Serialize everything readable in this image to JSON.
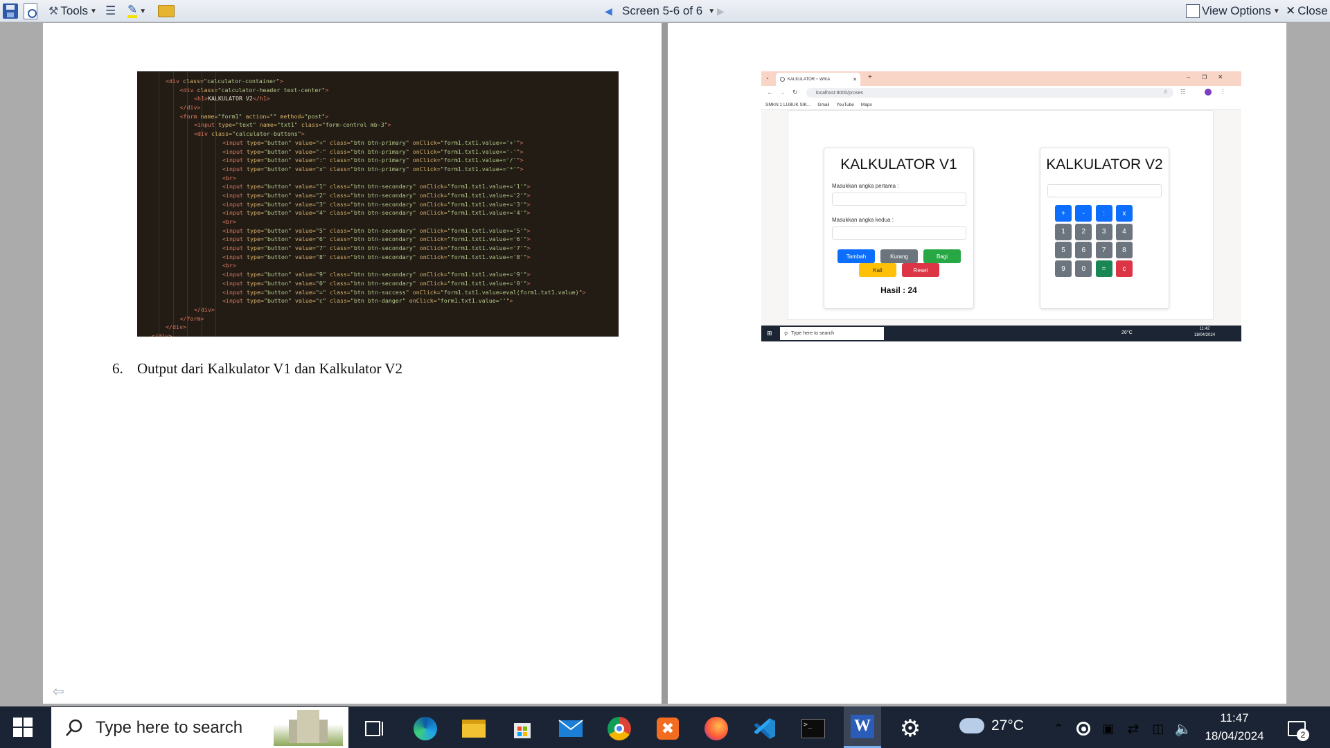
{
  "toolbar": {
    "tools_label": "Tools",
    "screen_label": "Screen 5-6 of 6",
    "view_options_label": "View Options",
    "close_label": "Close"
  },
  "left_page": {
    "code_lines": [
      {
        "indent": 2,
        "parts": [
          [
            "t",
            "<div "
          ],
          [
            "a",
            "class="
          ],
          [
            "s",
            "\"calculator-container\""
          ],
          [
            "t",
            ">"
          ]
        ]
      },
      {
        "indent": 3,
        "parts": [
          [
            "t",
            "<div "
          ],
          [
            "a",
            "class="
          ],
          [
            "s",
            "\"calculator-header text-center\""
          ],
          [
            "t",
            ">"
          ]
        ]
      },
      {
        "indent": 4,
        "parts": [
          [
            "t",
            "<h1>"
          ],
          [
            "p",
            "KALKULATOR V2"
          ],
          [
            "t",
            "</h1>"
          ]
        ]
      },
      {
        "indent": 3,
        "parts": [
          [
            "t",
            "</div>"
          ]
        ]
      },
      {
        "indent": 3,
        "parts": [
          [
            "t",
            "<form "
          ],
          [
            "a",
            "name="
          ],
          [
            "s",
            "\"form1\" "
          ],
          [
            "a",
            "action="
          ],
          [
            "s",
            "\"\" "
          ],
          [
            "a",
            "method="
          ],
          [
            "s",
            "\"post\""
          ],
          [
            "t",
            ">"
          ]
        ]
      },
      {
        "indent": 4,
        "parts": [
          [
            "t",
            "<input "
          ],
          [
            "a",
            "type="
          ],
          [
            "s",
            "\"text\" "
          ],
          [
            "a",
            "name="
          ],
          [
            "s",
            "\"txt1\" "
          ],
          [
            "a",
            "class="
          ],
          [
            "s",
            "\"form-control mb-3\""
          ],
          [
            "t",
            ">"
          ]
        ]
      },
      {
        "indent": 4,
        "parts": [
          [
            "t",
            "<div "
          ],
          [
            "a",
            "class="
          ],
          [
            "s",
            "\"calculator-buttons\""
          ],
          [
            "t",
            ">"
          ]
        ]
      },
      {
        "indent": 6,
        "parts": [
          [
            "t",
            "<input "
          ],
          [
            "a",
            "type="
          ],
          [
            "s",
            "\"button\" "
          ],
          [
            "a",
            "value="
          ],
          [
            "s",
            "\"+\" "
          ],
          [
            "a",
            "class="
          ],
          [
            "s",
            "\"btn btn-primary\" "
          ],
          [
            "a",
            "onClick="
          ],
          [
            "s",
            "\"form1.txt1.value+='+'\""
          ],
          [
            "t",
            ">"
          ]
        ]
      },
      {
        "indent": 6,
        "parts": [
          [
            "t",
            "<input "
          ],
          [
            "a",
            "type="
          ],
          [
            "s",
            "\"button\" "
          ],
          [
            "a",
            "value="
          ],
          [
            "s",
            "\"-\" "
          ],
          [
            "a",
            "class="
          ],
          [
            "s",
            "\"btn btn-primary\" "
          ],
          [
            "a",
            "onClick="
          ],
          [
            "s",
            "\"form1.txt1.value+='-'\""
          ],
          [
            "t",
            ">"
          ]
        ]
      },
      {
        "indent": 6,
        "parts": [
          [
            "t",
            "<input "
          ],
          [
            "a",
            "type="
          ],
          [
            "s",
            "\"button\" "
          ],
          [
            "a",
            "value="
          ],
          [
            "s",
            "\":\" "
          ],
          [
            "a",
            "class="
          ],
          [
            "s",
            "\"btn btn-primary\" "
          ],
          [
            "a",
            "onClick="
          ],
          [
            "s",
            "\"form1.txt1.value+='/'\""
          ],
          [
            "t",
            ">"
          ]
        ]
      },
      {
        "indent": 6,
        "parts": [
          [
            "t",
            "<input "
          ],
          [
            "a",
            "type="
          ],
          [
            "s",
            "\"button\" "
          ],
          [
            "a",
            "value="
          ],
          [
            "s",
            "\"x\" "
          ],
          [
            "a",
            "class="
          ],
          [
            "s",
            "\"btn btn-primary\" "
          ],
          [
            "a",
            "onClick="
          ],
          [
            "s",
            "\"form1.txt1.value+='*'\""
          ],
          [
            "t",
            ">"
          ]
        ]
      },
      {
        "indent": 6,
        "parts": [
          [
            "t",
            "<br>"
          ]
        ]
      },
      {
        "indent": 6,
        "parts": [
          [
            "t",
            "<input "
          ],
          [
            "a",
            "type="
          ],
          [
            "s",
            "\"button\" "
          ],
          [
            "a",
            "value="
          ],
          [
            "s",
            "\"1\" "
          ],
          [
            "a",
            "class="
          ],
          [
            "s",
            "\"btn btn-secondary\" "
          ],
          [
            "a",
            "onClick="
          ],
          [
            "s",
            "\"form1.txt1.value+='1'\""
          ],
          [
            "t",
            ">"
          ]
        ]
      },
      {
        "indent": 6,
        "parts": [
          [
            "t",
            "<input "
          ],
          [
            "a",
            "type="
          ],
          [
            "s",
            "\"button\" "
          ],
          [
            "a",
            "value="
          ],
          [
            "s",
            "\"2\" "
          ],
          [
            "a",
            "class="
          ],
          [
            "s",
            "\"btn btn-secondary\" "
          ],
          [
            "a",
            "onClick="
          ],
          [
            "s",
            "\"form1.txt1.value+='2'\""
          ],
          [
            "t",
            ">"
          ]
        ]
      },
      {
        "indent": 6,
        "parts": [
          [
            "t",
            "<input "
          ],
          [
            "a",
            "type="
          ],
          [
            "s",
            "\"button\" "
          ],
          [
            "a",
            "value="
          ],
          [
            "s",
            "\"3\" "
          ],
          [
            "a",
            "class="
          ],
          [
            "s",
            "\"btn btn-secondary\" "
          ],
          [
            "a",
            "onClick="
          ],
          [
            "s",
            "\"form1.txt1.value+='3'\""
          ],
          [
            "t",
            ">"
          ]
        ]
      },
      {
        "indent": 6,
        "parts": [
          [
            "t",
            "<input "
          ],
          [
            "a",
            "type="
          ],
          [
            "s",
            "\"button\" "
          ],
          [
            "a",
            "value="
          ],
          [
            "s",
            "\"4\" "
          ],
          [
            "a",
            "class="
          ],
          [
            "s",
            "\"btn btn-secondary\" "
          ],
          [
            "a",
            "onClick="
          ],
          [
            "s",
            "\"form1.txt1.value+='4'\""
          ],
          [
            "t",
            ">"
          ]
        ]
      },
      {
        "indent": 6,
        "parts": [
          [
            "t",
            "<br>"
          ]
        ]
      },
      {
        "indent": 6,
        "parts": [
          [
            "t",
            "<input "
          ],
          [
            "a",
            "type="
          ],
          [
            "s",
            "\"button\" "
          ],
          [
            "a",
            "value="
          ],
          [
            "s",
            "\"5\" "
          ],
          [
            "a",
            "class="
          ],
          [
            "s",
            "\"btn btn-secondary\" "
          ],
          [
            "a",
            "onClick="
          ],
          [
            "s",
            "\"form1.txt1.value+='5'\""
          ],
          [
            "t",
            ">"
          ]
        ]
      },
      {
        "indent": 6,
        "parts": [
          [
            "t",
            "<input "
          ],
          [
            "a",
            "type="
          ],
          [
            "s",
            "\"button\" "
          ],
          [
            "a",
            "value="
          ],
          [
            "s",
            "\"6\" "
          ],
          [
            "a",
            "class="
          ],
          [
            "s",
            "\"btn btn-secondary\" "
          ],
          [
            "a",
            "onClick="
          ],
          [
            "s",
            "\"form1.txt1.value+='6'\""
          ],
          [
            "t",
            ">"
          ]
        ]
      },
      {
        "indent": 6,
        "parts": [
          [
            "t",
            "<input "
          ],
          [
            "a",
            "type="
          ],
          [
            "s",
            "\"button\" "
          ],
          [
            "a",
            "value="
          ],
          [
            "s",
            "\"7\" "
          ],
          [
            "a",
            "class="
          ],
          [
            "s",
            "\"btn btn-secondary\" "
          ],
          [
            "a",
            "onClick="
          ],
          [
            "s",
            "\"form1.txt1.value+='7'\""
          ],
          [
            "t",
            ">"
          ]
        ]
      },
      {
        "indent": 6,
        "parts": [
          [
            "t",
            "<input "
          ],
          [
            "a",
            "type="
          ],
          [
            "s",
            "\"button\" "
          ],
          [
            "a",
            "value="
          ],
          [
            "s",
            "\"8\" "
          ],
          [
            "a",
            "class="
          ],
          [
            "s",
            "\"btn btn-secondary\" "
          ],
          [
            "a",
            "onClick="
          ],
          [
            "s",
            "\"form1.txt1.value+='8'\""
          ],
          [
            "t",
            ">"
          ]
        ]
      },
      {
        "indent": 6,
        "parts": [
          [
            "t",
            "<br>"
          ]
        ]
      },
      {
        "indent": 6,
        "parts": [
          [
            "t",
            "<input "
          ],
          [
            "a",
            "type="
          ],
          [
            "s",
            "\"button\" "
          ],
          [
            "a",
            "value="
          ],
          [
            "s",
            "\"9\" "
          ],
          [
            "a",
            "class="
          ],
          [
            "s",
            "\"btn btn-secondary\" "
          ],
          [
            "a",
            "onClick="
          ],
          [
            "s",
            "\"form1.txt1.value+='9'\""
          ],
          [
            "t",
            ">"
          ]
        ]
      },
      {
        "indent": 6,
        "parts": [
          [
            "t",
            "<input "
          ],
          [
            "a",
            "type="
          ],
          [
            "s",
            "\"button\" "
          ],
          [
            "a",
            "value="
          ],
          [
            "s",
            "\"0\" "
          ],
          [
            "a",
            "class="
          ],
          [
            "s",
            "\"btn btn-secondary\" "
          ],
          [
            "a",
            "onClick="
          ],
          [
            "s",
            "\"form1.txt1.value+='0'\""
          ],
          [
            "t",
            ">"
          ]
        ]
      },
      {
        "indent": 6,
        "parts": [
          [
            "t",
            "<input "
          ],
          [
            "a",
            "type="
          ],
          [
            "s",
            "\"button\" "
          ],
          [
            "a",
            "value="
          ],
          [
            "s",
            "\"=\" "
          ],
          [
            "a",
            "class="
          ],
          [
            "s",
            "\"btn btn-success\" "
          ],
          [
            "a",
            "onClick="
          ],
          [
            "s",
            "\"form1.txt1.value=eval(form1.txt1.value)\""
          ],
          [
            "t",
            ">"
          ]
        ]
      },
      {
        "indent": 6,
        "parts": [
          [
            "t",
            "<input "
          ],
          [
            "a",
            "type="
          ],
          [
            "s",
            "\"button\" "
          ],
          [
            "a",
            "value="
          ],
          [
            "s",
            "\"c\" "
          ],
          [
            "a",
            "class="
          ],
          [
            "s",
            "\"btn btn-danger\" "
          ],
          [
            "a",
            "onClick="
          ],
          [
            "s",
            "\"form1.txt1.value=''\""
          ],
          [
            "t",
            ">"
          ]
        ]
      },
      {
        "indent": 4,
        "parts": [
          [
            "t",
            "</div>"
          ]
        ]
      },
      {
        "indent": 3,
        "parts": [
          [
            "t",
            "</form>"
          ]
        ]
      },
      {
        "indent": 2,
        "parts": [
          [
            "t",
            "</div>"
          ]
        ]
      },
      {
        "indent": 1,
        "parts": [
          [
            "t",
            "</div>"
          ]
        ]
      }
    ],
    "heading_number": "6.",
    "heading_text": "Output dari Kalkulator V1 dan Kalkulator V2"
  },
  "browser": {
    "tab_title": "KALKULATOR ~ WIKA",
    "url": "localhost:8000/proses",
    "bookmarks": [
      "SMKN 1 LUBUK SIK...",
      "Gmail",
      "YouTube",
      "Maps"
    ],
    "calc_v1": {
      "title": "KALKULATOR V1",
      "label1": "Masukkan angka pertama :",
      "label2": "Masukkan angka kedua :",
      "buttons": [
        "Tambah",
        "Kurang",
        "Bagi",
        "Kali",
        "Reset"
      ],
      "result": "Hasil : 24"
    },
    "calc_v2": {
      "title": "KALKULATOR V2",
      "keys": [
        "+",
        "-",
        ":",
        "x",
        "1",
        "2",
        "3",
        "4",
        "5",
        "6",
        "7",
        "8",
        "9",
        "0",
        "=",
        "c"
      ]
    },
    "mini_taskbar": {
      "search_placeholder": "Type here to search",
      "temp": "26°C",
      "time": "11:42",
      "date": "18/04/2024"
    }
  },
  "taskbar": {
    "search_placeholder": "Type here to search",
    "temperature": "27°C",
    "time": "11:47",
    "date": "18/04/2024",
    "notification_count": "2"
  },
  "colors": {
    "primary": "#0d6efd",
    "secondary": "#6c757d",
    "success": "#198754",
    "warning": "#ffc107",
    "danger": "#dc3545",
    "code_bg": "#221c15",
    "taskbar": "#1b2434"
  }
}
